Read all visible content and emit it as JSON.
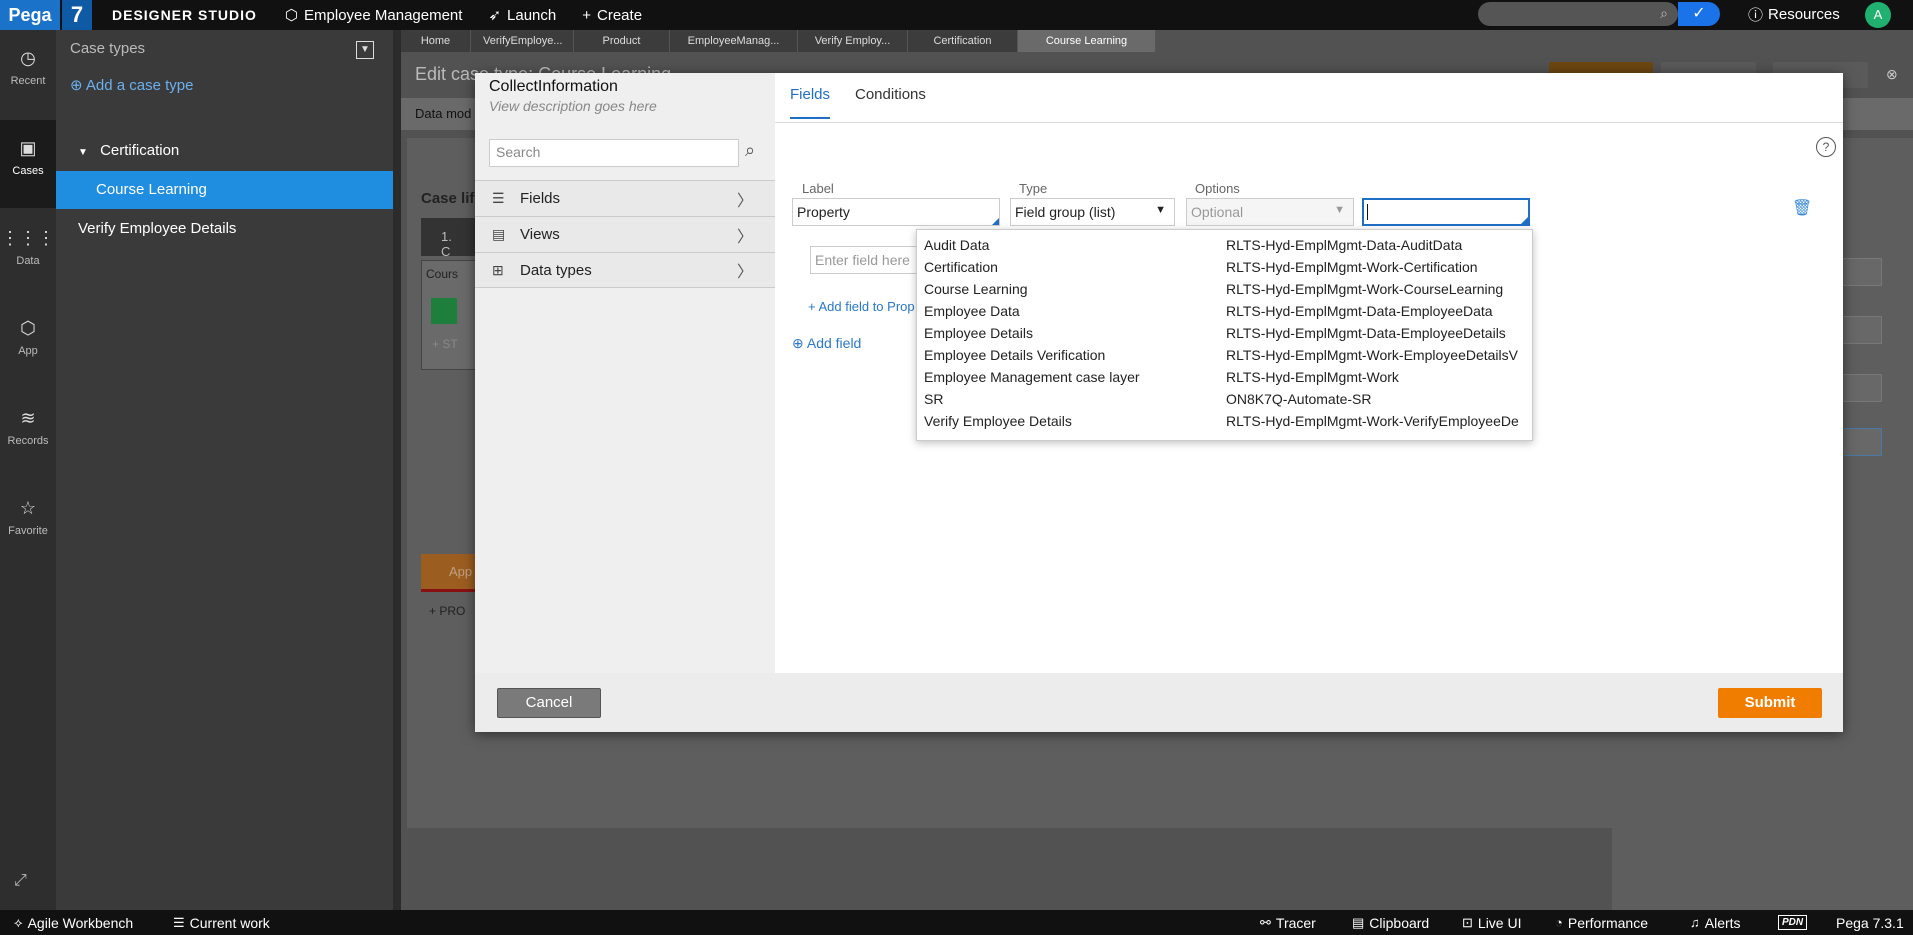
{
  "topbar": {
    "logo": "Pega",
    "version_badge": "7",
    "studio": "DESIGNER STUDIO",
    "app": "Employee Management",
    "launch": "Launch",
    "create": "Create",
    "resources": "Resources",
    "avatar": "A"
  },
  "rail": [
    {
      "label": "Recent",
      "icon": "clock-icon"
    },
    {
      "label": "Cases",
      "icon": "briefcase-icon"
    },
    {
      "label": "Data",
      "icon": "grid-icon"
    },
    {
      "label": "App",
      "icon": "cube-icon"
    },
    {
      "label": "Records",
      "icon": "layers-icon"
    },
    {
      "label": "Favorite",
      "icon": "star-icon"
    }
  ],
  "case_types": {
    "header": "Case types",
    "add": "Add a case type",
    "items": [
      "Certification",
      "Course Learning",
      "Verify Employee Details"
    ]
  },
  "tabs": [
    "Home",
    "VerifyEmploye...",
    "Product",
    "EmployeeManag...",
    "Verify Employ...",
    "Certification",
    "Course Learning"
  ],
  "main": {
    "title": "Edit case type: Course Learning",
    "strip": "Data mod",
    "lifecycle": "Case life",
    "stage": "1.  C",
    "stage_sub": "Cours",
    "step": "+ ST",
    "alt_stage": "App",
    "process": "PRO"
  },
  "modal": {
    "title": "CollectInformation",
    "description": "View description goes here",
    "search_placeholder": "Search",
    "nav": [
      {
        "label": "Fields",
        "icon": "list-icon"
      },
      {
        "label": "Views",
        "icon": "clipboard-icon"
      },
      {
        "label": "Data types",
        "icon": "grid-icon"
      }
    ],
    "tabs": [
      "Fields",
      "Conditions"
    ],
    "field": {
      "label_header": "Label",
      "type_header": "Type",
      "options_header": "Options",
      "label_value": "Property",
      "type_value": "Field group (list)",
      "options_value": "Optional"
    },
    "enter_field_placeholder": "Enter field here",
    "add_field_to_prop": "+ Add field to Prop",
    "add_field": "Add field",
    "cancel": "Cancel",
    "submit": "Submit"
  },
  "popup": [
    {
      "name": "Audit Data",
      "class": "RLTS-Hyd-EmplMgmt-Data-AuditData"
    },
    {
      "name": "Certification",
      "class": "RLTS-Hyd-EmplMgmt-Work-Certification"
    },
    {
      "name": "Course Learning",
      "class": "RLTS-Hyd-EmplMgmt-Work-CourseLearning"
    },
    {
      "name": "Employee Data",
      "class": "RLTS-Hyd-EmplMgmt-Data-EmployeeData"
    },
    {
      "name": "Employee Details",
      "class": "RLTS-Hyd-EmplMgmt-Data-EmployeeDetails"
    },
    {
      "name": "Employee Details Verification",
      "class": "RLTS-Hyd-EmplMgmt-Work-EmployeeDetailsV"
    },
    {
      "name": "Employee Management case layer",
      "class": "RLTS-Hyd-EmplMgmt-Work"
    },
    {
      "name": "SR",
      "class": "ON8K7Q-Automate-SR"
    },
    {
      "name": "Verify Employee Details",
      "class": "RLTS-Hyd-EmplMgmt-Work-VerifyEmployeeDe"
    }
  ],
  "bottombar": {
    "agile": "Agile Workbench",
    "current": "Current work",
    "tracer": "Tracer",
    "clipboard": "Clipboard",
    "liveui": "Live UI",
    "performance": "Performance",
    "alerts": "Alerts",
    "pdn": "PDN",
    "version": "Pega 7.3.1"
  }
}
